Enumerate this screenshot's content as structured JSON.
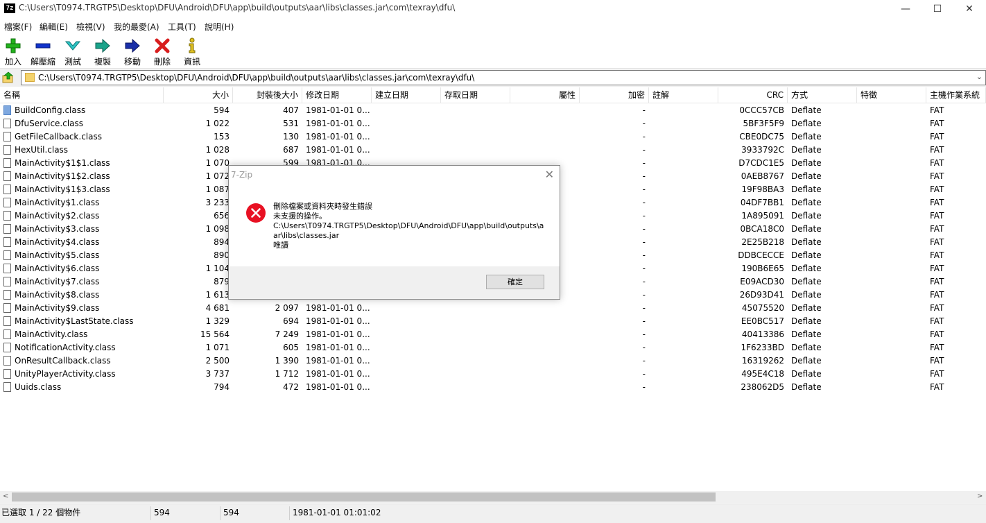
{
  "window": {
    "title": "C:\\Users\\T0974.TRGTP5\\Desktop\\DFU\\Android\\DFU\\app\\build\\outputs\\aar\\libs\\classes.jar\\com\\texray\\dfu\\",
    "app_icon_text": "7z",
    "minimize": "—",
    "maximize": "☐",
    "close": "✕"
  },
  "menu": [
    "檔案(F)",
    "編輯(E)",
    "檢視(V)",
    "我的最愛(A)",
    "工具(T)",
    "說明(H)"
  ],
  "toolbar": {
    "add": "加入",
    "extract": "解壓縮",
    "test": "測試",
    "copy": "複製",
    "move": "移動",
    "delete": "刪除",
    "info": "資訊"
  },
  "address": {
    "path": "C:\\Users\\T0974.TRGTP5\\Desktop\\DFU\\Android\\DFU\\app\\build\\outputs\\aar\\libs\\classes.jar\\com\\texray\\dfu\\"
  },
  "columns": {
    "name": "名稱",
    "size": "大小",
    "packed": "封裝後大小",
    "modified": "修改日期",
    "created": "建立日期",
    "accessed": "存取日期",
    "attributes": "屬性",
    "encrypted": "加密",
    "comment": "註解",
    "crc": "CRC",
    "method": "方式",
    "characteristics": "特徵",
    "host_os": "主機作業系統"
  },
  "files": [
    {
      "name": "BuildConfig.class",
      "size": "594",
      "packed": "407",
      "modified": "1981-01-01 0...",
      "encrypted": "-",
      "crc": "0CCC57CB",
      "method": "Deflate",
      "os": "FAT",
      "selected": true
    },
    {
      "name": "DfuService.class",
      "size": "1 022",
      "packed": "531",
      "modified": "1981-01-01 0...",
      "encrypted": "-",
      "crc": "5BF3F5F9",
      "method": "Deflate",
      "os": "FAT"
    },
    {
      "name": "GetFileCallback.class",
      "size": "153",
      "packed": "130",
      "modified": "1981-01-01 0...",
      "encrypted": "-",
      "crc": "CBE0DC75",
      "method": "Deflate",
      "os": "FAT"
    },
    {
      "name": "HexUtil.class",
      "size": "1 028",
      "packed": "687",
      "modified": "1981-01-01 0...",
      "encrypted": "-",
      "crc": "3933792C",
      "method": "Deflate",
      "os": "FAT"
    },
    {
      "name": "MainActivity$1$1.class",
      "size": "1 070",
      "packed": "599",
      "modified": "1981-01-01 0...",
      "encrypted": "-",
      "crc": "D7CDC1E5",
      "method": "Deflate",
      "os": "FAT"
    },
    {
      "name": "MainActivity$1$2.class",
      "size": "1 072",
      "packed": "",
      "modified": "",
      "encrypted": "-",
      "crc": "0AEB8767",
      "method": "Deflate",
      "os": "FAT"
    },
    {
      "name": "MainActivity$1$3.class",
      "size": "1 087",
      "packed": "",
      "modified": "",
      "encrypted": "-",
      "crc": "19F98BA3",
      "method": "Deflate",
      "os": "FAT"
    },
    {
      "name": "MainActivity$1.class",
      "size": "3 233",
      "packed": "",
      "modified": "",
      "encrypted": "-",
      "crc": "04DF7BB1",
      "method": "Deflate",
      "os": "FAT"
    },
    {
      "name": "MainActivity$2.class",
      "size": "656",
      "packed": "",
      "modified": "",
      "encrypted": "-",
      "crc": "1A895091",
      "method": "Deflate",
      "os": "FAT"
    },
    {
      "name": "MainActivity$3.class",
      "size": "1 098",
      "packed": "",
      "modified": "",
      "encrypted": "-",
      "crc": "0BCA18C0",
      "method": "Deflate",
      "os": "FAT"
    },
    {
      "name": "MainActivity$4.class",
      "size": "894",
      "packed": "",
      "modified": "",
      "encrypted": "-",
      "crc": "2E25B218",
      "method": "Deflate",
      "os": "FAT"
    },
    {
      "name": "MainActivity$5.class",
      "size": "890",
      "packed": "",
      "modified": "",
      "encrypted": "-",
      "crc": "DDBCECCE",
      "method": "Deflate",
      "os": "FAT"
    },
    {
      "name": "MainActivity$6.class",
      "size": "1 104",
      "packed": "",
      "modified": "",
      "encrypted": "-",
      "crc": "190B6E65",
      "method": "Deflate",
      "os": "FAT"
    },
    {
      "name": "MainActivity$7.class",
      "size": "879",
      "packed": "",
      "modified": "",
      "encrypted": "-",
      "crc": "E09ACD30",
      "method": "Deflate",
      "os": "FAT"
    },
    {
      "name": "MainActivity$8.class",
      "size": "1 613",
      "packed": "",
      "modified": "",
      "encrypted": "-",
      "crc": "26D93D41",
      "method": "Deflate",
      "os": "FAT"
    },
    {
      "name": "MainActivity$9.class",
      "size": "4 681",
      "packed": "2 097",
      "modified": "1981-01-01 0...",
      "encrypted": "-",
      "crc": "45075520",
      "method": "Deflate",
      "os": "FAT"
    },
    {
      "name": "MainActivity$LastState.class",
      "size": "1 329",
      "packed": "694",
      "modified": "1981-01-01 0...",
      "encrypted": "-",
      "crc": "EE0BC517",
      "method": "Deflate",
      "os": "FAT"
    },
    {
      "name": "MainActivity.class",
      "size": "15 564",
      "packed": "7 249",
      "modified": "1981-01-01 0...",
      "encrypted": "-",
      "crc": "40413386",
      "method": "Deflate",
      "os": "FAT"
    },
    {
      "name": "NotificationActivity.class",
      "size": "1 071",
      "packed": "605",
      "modified": "1981-01-01 0...",
      "encrypted": "-",
      "crc": "1F6233BD",
      "method": "Deflate",
      "os": "FAT"
    },
    {
      "name": "OnResultCallback.class",
      "size": "2 500",
      "packed": "1 390",
      "modified": "1981-01-01 0...",
      "encrypted": "-",
      "crc": "16319262",
      "method": "Deflate",
      "os": "FAT"
    },
    {
      "name": "UnityPlayerActivity.class",
      "size": "3 737",
      "packed": "1 712",
      "modified": "1981-01-01 0...",
      "encrypted": "-",
      "crc": "495E4C18",
      "method": "Deflate",
      "os": "FAT"
    },
    {
      "name": "Uuids.class",
      "size": "794",
      "packed": "472",
      "modified": "1981-01-01 0...",
      "encrypted": "-",
      "crc": "238062D5",
      "method": "Deflate",
      "os": "FAT"
    }
  ],
  "status": {
    "selection": "已選取 1 / 22 個物件",
    "size": "594",
    "packed": "594",
    "modified": "1981-01-01 01:01:02"
  },
  "dialog": {
    "title": "7-Zip",
    "close": "✕",
    "lines": [
      "刪除檔案或資料夾時發生錯誤",
      "未支援的操作。",
      "C:\\Users\\T0974.TRGTP5\\Desktop\\DFU\\Android\\DFU\\app\\build\\outputs\\a",
      "ar\\libs\\classes.jar",
      "唯讀"
    ],
    "ok": "確定"
  },
  "scroll": {
    "left_arrow": "<",
    "right_arrow": ">"
  },
  "colors": {
    "error_red": "#e81123",
    "selection_icon": "#7fa8df",
    "folder": "#f4d36c"
  }
}
